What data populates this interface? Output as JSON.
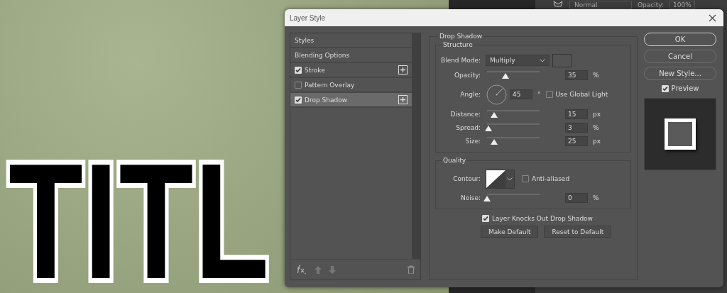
{
  "canvas": {
    "text": "TITL"
  },
  "options_bar": {
    "blend_mode": "Normal",
    "opacity_label": "Opacity:",
    "opacity_value": "100%"
  },
  "dialog": {
    "title": "Layer Style",
    "styles_list": [
      {
        "label": "Styles",
        "kind": "header",
        "selected": false
      },
      {
        "label": "Blending Options",
        "kind": "header",
        "selected": false
      },
      {
        "label": "Stroke",
        "kind": "effect",
        "checked": true,
        "add_button": true,
        "selected": false
      },
      {
        "label": "Pattern Overlay",
        "kind": "effect",
        "checked": false,
        "add_button": false,
        "selected": false
      },
      {
        "label": "Drop Shadow",
        "kind": "effect",
        "checked": true,
        "add_button": true,
        "selected": true
      }
    ],
    "panel_title": "Drop Shadow",
    "structure": {
      "title": "Structure",
      "blend_mode_label": "Blend Mode:",
      "blend_mode": "Multiply",
      "opacity": {
        "label": "Opacity:",
        "level": 0.35,
        "value": "35",
        "unit": "%"
      },
      "angle": {
        "label": "Angle:",
        "value": "45",
        "unit": "°",
        "global_light_label": "Use Global Light",
        "global_light": false
      },
      "sliders": [
        {
          "label": "Distance:",
          "level": 0.13,
          "value": "15",
          "unit": "px"
        },
        {
          "label": "Spread:",
          "level": 0.03,
          "value": "3",
          "unit": "%"
        },
        {
          "label": "Size:",
          "level": 0.13,
          "value": "25",
          "unit": "px"
        }
      ]
    },
    "quality": {
      "title": "Quality",
      "contour_label": "Contour:",
      "anti_aliased_label": "Anti-aliased",
      "anti_aliased": false,
      "noise": {
        "label": "Noise:",
        "level": 0.0,
        "value": "0",
        "unit": "%"
      }
    },
    "knockout_label": "Layer Knocks Out Drop Shadow",
    "knockout": true,
    "make_default": "Make Default",
    "reset_default": "Reset to Default",
    "buttons": [
      "OK",
      "Cancel",
      "New Style..."
    ],
    "preview_label": "Preview",
    "preview": true
  }
}
